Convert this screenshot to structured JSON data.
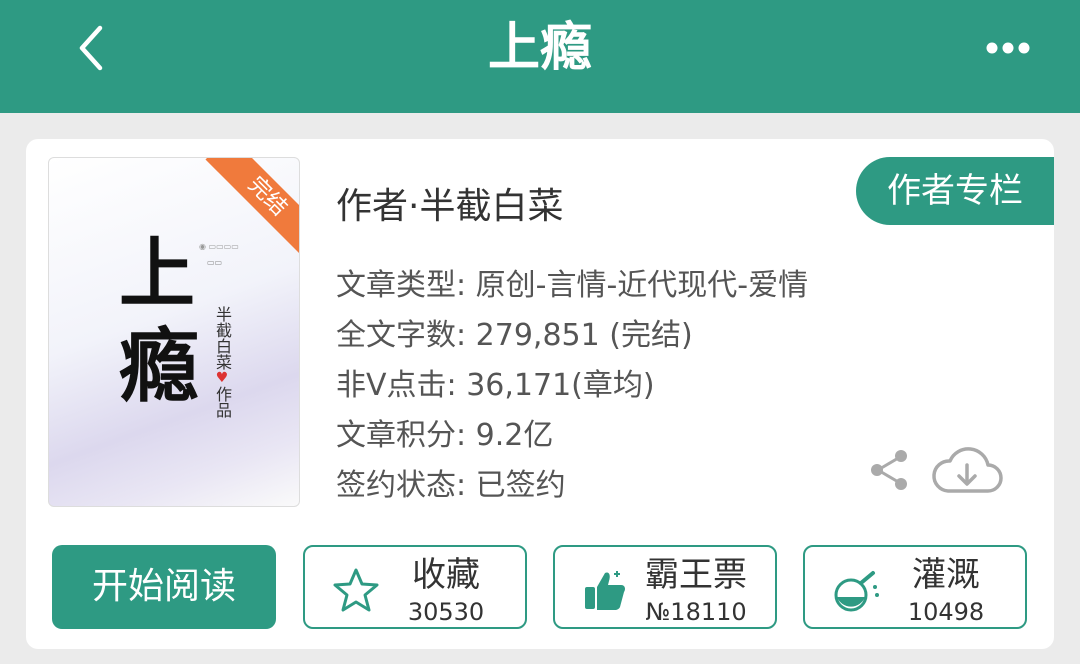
{
  "header": {
    "title": "上瘾",
    "back_icon": "chevron-left-icon",
    "more_icon": "more-horizontal-icon"
  },
  "cover": {
    "title_chars": [
      "上",
      "瘾"
    ],
    "author_vertical": "半截白菜",
    "works_label": "作品",
    "ribbon": "完结"
  },
  "book": {
    "author": "作者·半截白菜",
    "author_column_button": "作者专栏",
    "info": [
      {
        "label": "文章类型:",
        "value": "原创-言情-近代现代-爱情"
      },
      {
        "label": "全文字数:",
        "value": "279,851 (完结)"
      },
      {
        "label": "非V点击:",
        "value": "36,171(章均)"
      },
      {
        "label": "文章积分:",
        "value": "9.2亿"
      },
      {
        "label": "签约状态:",
        "value": "已签约"
      }
    ]
  },
  "actions": {
    "read_button": "开始阅读",
    "stats": [
      {
        "label": "收藏",
        "count": "30530",
        "icon": "star-icon"
      },
      {
        "label": "霸王票",
        "count": "№18110",
        "icon": "thumbs-up-icon"
      },
      {
        "label": "灌溉",
        "count": "10498",
        "icon": "nutrient-flask-icon"
      }
    ]
  },
  "colors": {
    "brand": "#2e9a83",
    "ribbon": "#f07a3c",
    "background": "#ebebeb"
  }
}
